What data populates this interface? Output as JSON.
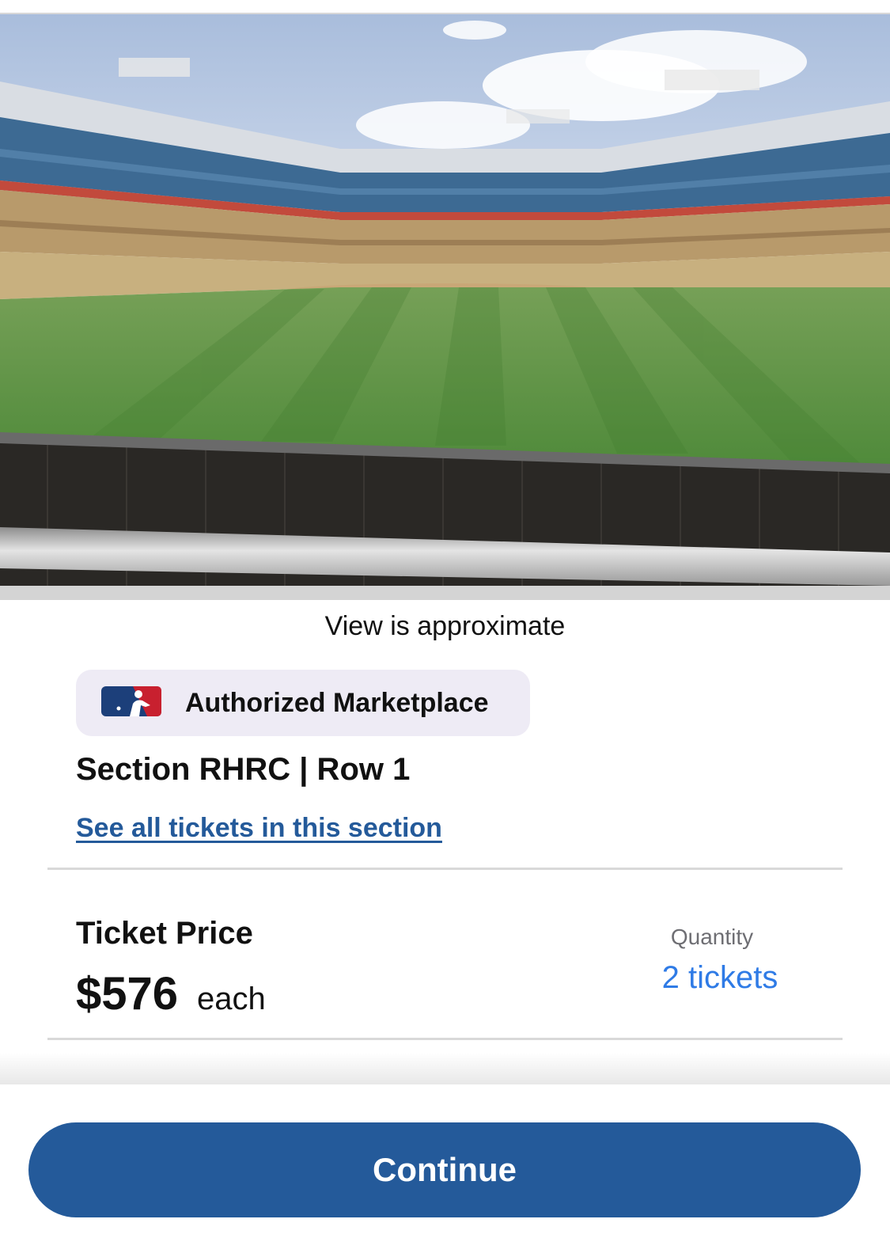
{
  "view": {
    "image_name": "stadium-view-image",
    "caption": "View is approximate"
  },
  "badge": {
    "icon": "mlb-logo-icon",
    "label": "Authorized Marketplace"
  },
  "listing": {
    "section_row": "Section RHRC | Row 1",
    "section_link": "See all tickets in this section"
  },
  "price": {
    "label": "Ticket Price",
    "amount": "$576",
    "suffix": "each"
  },
  "quantity": {
    "label": "Quantity",
    "value": "2 tickets"
  },
  "footer": {
    "continue_label": "Continue"
  },
  "colors": {
    "brand_blue": "#245a9a",
    "link_blue": "#2f7be6",
    "badge_bg": "#eeebf5"
  }
}
